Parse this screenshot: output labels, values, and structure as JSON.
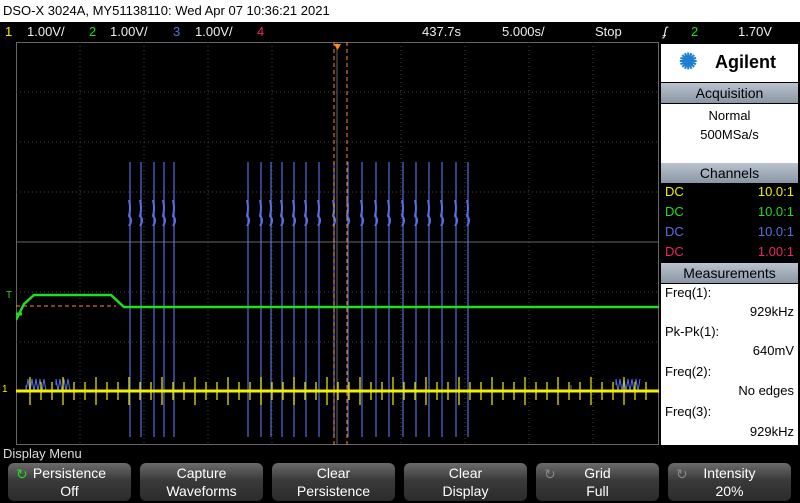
{
  "title": "DSO-X 3024A, MY51138110: Wed Apr 07 10:36:21 2021",
  "status": {
    "ch1_num": "1",
    "ch1_scale": "1.00V/",
    "ch2_num": "2",
    "ch2_scale": "1.00V/",
    "ch3_num": "3",
    "ch3_scale": "1.00V/",
    "ch4_num": "4",
    "delay": "437.7s",
    "timebase": "5.000s/",
    "run_state": "Stop",
    "trigger_symbol": "ʄ",
    "trigger_channel": "2",
    "trigger_level": "1.70V"
  },
  "colors": {
    "ch1": "#f2f200",
    "ch2": "#22dd22",
    "ch3": "#5a6ee6",
    "ch4": "#ee2266",
    "orange": "#ff8c1a"
  },
  "panel": {
    "brand": "Agilent",
    "acquisition_header": "Acquisition",
    "acq_mode": "Normal",
    "acq_rate": "500MSa/s",
    "channels_header": "Channels",
    "channels": [
      {
        "coupling": "DC",
        "probe": "10.0:1"
      },
      {
        "coupling": "DC",
        "probe": "10.0:1"
      },
      {
        "coupling": "DC",
        "probe": "10.0:1"
      },
      {
        "coupling": "DC",
        "probe": "1.00:1"
      }
    ],
    "measurements_header": "Measurements",
    "measurements": [
      {
        "label": "Freq(1):",
        "value": "929kHz"
      },
      {
        "label": "Pk-Pk(1):",
        "value": "640mV"
      },
      {
        "label": "Freq(2):",
        "value": "No edges"
      },
      {
        "label": "Freq(3):",
        "value": "929kHz"
      }
    ]
  },
  "menu_label": "Display Menu",
  "softkeys": [
    {
      "l1": "Persistence",
      "l2": "Off"
    },
    {
      "l1": "Capture",
      "l2": "Waveforms"
    },
    {
      "l1": "Clear",
      "l2": "Persistence"
    },
    {
      "l1": "Clear",
      "l2": "Display"
    },
    {
      "l1": "Grid",
      "l2": "Full"
    },
    {
      "l1": "Intensity",
      "l2": "20%"
    }
  ],
  "markers": {
    "trigger_left": "T",
    "ch1_ground": "1"
  }
}
